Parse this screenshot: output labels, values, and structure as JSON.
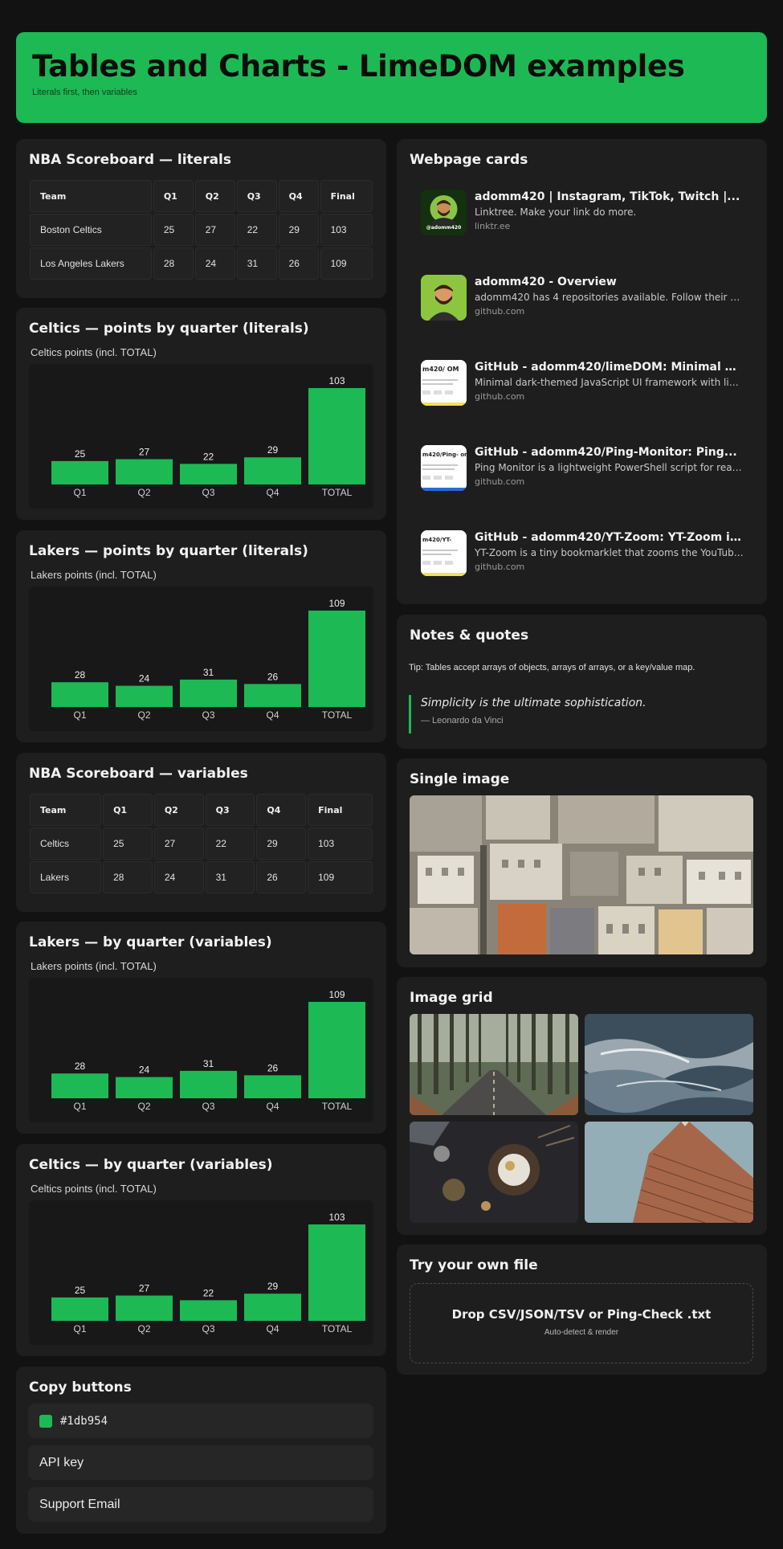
{
  "header": {
    "title": "Tables and Charts - LimeDOM examples",
    "subtitle": "Literals first, then variables"
  },
  "scoreboard_literals": {
    "title": "NBA Scoreboard — literals",
    "columns": [
      "Team",
      "Q1",
      "Q2",
      "Q3",
      "Q4",
      "Final"
    ],
    "rows": [
      [
        "Boston Celtics",
        "25",
        "27",
        "22",
        "29",
        "103"
      ],
      [
        "Los Angeles Lakers",
        "28",
        "24",
        "31",
        "26",
        "109"
      ]
    ]
  },
  "scoreboard_variables": {
    "title": "NBA Scoreboard — variables",
    "columns": [
      "Team",
      "Q1",
      "Q2",
      "Q3",
      "Q4",
      "Final"
    ],
    "rows": [
      [
        "Celtics",
        "25",
        "27",
        "22",
        "29",
        "103"
      ],
      [
        "Lakers",
        "28",
        "24",
        "31",
        "26",
        "109"
      ]
    ]
  },
  "charts": {
    "celtics_literals_title": "Celtics — points by quarter (literals)",
    "lakers_literals_title": "Lakers — points by quarter (literals)",
    "lakers_variables_title": "Lakers — by quarter (variables)",
    "celtics_variables_title": "Celtics — by quarter (variables)"
  },
  "chart_data": [
    {
      "type": "bar",
      "title": "Celtics points (incl. TOTAL)",
      "categories": [
        "Q1",
        "Q2",
        "Q3",
        "Q4",
        "TOTAL"
      ],
      "values": [
        25,
        27,
        22,
        29,
        103
      ],
      "ylim": [
        0,
        103
      ],
      "grid": false,
      "color": "#1db954"
    },
    {
      "type": "bar",
      "title": "Lakers points (incl. TOTAL)",
      "categories": [
        "Q1",
        "Q2",
        "Q3",
        "Q4",
        "TOTAL"
      ],
      "values": [
        28,
        24,
        31,
        26,
        109
      ],
      "ylim": [
        0,
        109
      ],
      "grid": false,
      "color": "#1db954"
    },
    {
      "type": "bar",
      "title": "Lakers points (incl. TOTAL)",
      "categories": [
        "Q1",
        "Q2",
        "Q3",
        "Q4",
        "TOTAL"
      ],
      "values": [
        28,
        24,
        31,
        26,
        109
      ],
      "ylim": [
        0,
        109
      ],
      "grid": false,
      "color": "#1db954"
    },
    {
      "type": "bar",
      "title": "Celtics points (incl. TOTAL)",
      "categories": [
        "Q1",
        "Q2",
        "Q3",
        "Q4",
        "TOTAL"
      ],
      "values": [
        25,
        27,
        22,
        29,
        103
      ],
      "ylim": [
        0,
        103
      ],
      "grid": false,
      "color": "#1db954"
    }
  ],
  "webpage_cards": {
    "title": "Webpage cards",
    "items": [
      {
        "title": "adomm420 | Instagram, TikTok, Twitch |...",
        "desc": "Linktree. Make your link do more.",
        "domain": "linktr.ee",
        "thumb_text": "@adomm420",
        "icon": "linktree-avatar-icon"
      },
      {
        "title": "adomm420 - Overview",
        "desc": "adomm420 has 4 repositories available. Follow their co...",
        "domain": "github.com",
        "icon": "github-avatar-icon"
      },
      {
        "title": "GitHub - adomm420/limeDOM: Minimal dar...",
        "desc": "Minimal dark-themed JavaScript UI framework with lim...",
        "domain": "github.com",
        "thumb_text": "m420/ OM",
        "icon": "repo-preview-icon"
      },
      {
        "title": "GitHub - adomm420/Ping-Monitor: Ping...",
        "desc": "Ping Monitor is a lightweight PowerShell script for real-...",
        "domain": "github.com",
        "thumb_text": "m420/Ping- or",
        "icon": "repo-preview-icon"
      },
      {
        "title": "GitHub - adomm420/YT-Zoom: YT-Zoom is ...",
        "desc": "YT-Zoom is a tiny bookmarklet that zooms the YouTube...",
        "domain": "github.com",
        "thumb_text": "m420/YT-",
        "icon": "repo-preview-icon"
      }
    ]
  },
  "notes": {
    "title": "Notes & quotes",
    "tip": "Tip: Tables accept arrays of objects, arrays of arrays, or a key/value map.",
    "quote": "Simplicity is the ultimate sophistication.",
    "author": "— Leonardo da Vinci"
  },
  "single_image": {
    "title": "Single image",
    "alt": "city-rooftops-photo"
  },
  "image_grid": {
    "title": "Image grid",
    "images": [
      "forest-road-photo",
      "ocean-wave-photo",
      "food-table-photo",
      "flatiron-building-photo"
    ]
  },
  "dropzone": {
    "title": "Try your own file",
    "label": "Drop CSV/JSON/TSV or Ping-Check .txt",
    "sub": "Auto-detect & render"
  },
  "copy_buttons": {
    "title": "Copy buttons",
    "color_value": "#1db954",
    "api_label": "API key",
    "support_label": "Support Email"
  },
  "colors": {
    "accent": "#1db954",
    "background": "#121212",
    "card": "#1e1e1e"
  }
}
